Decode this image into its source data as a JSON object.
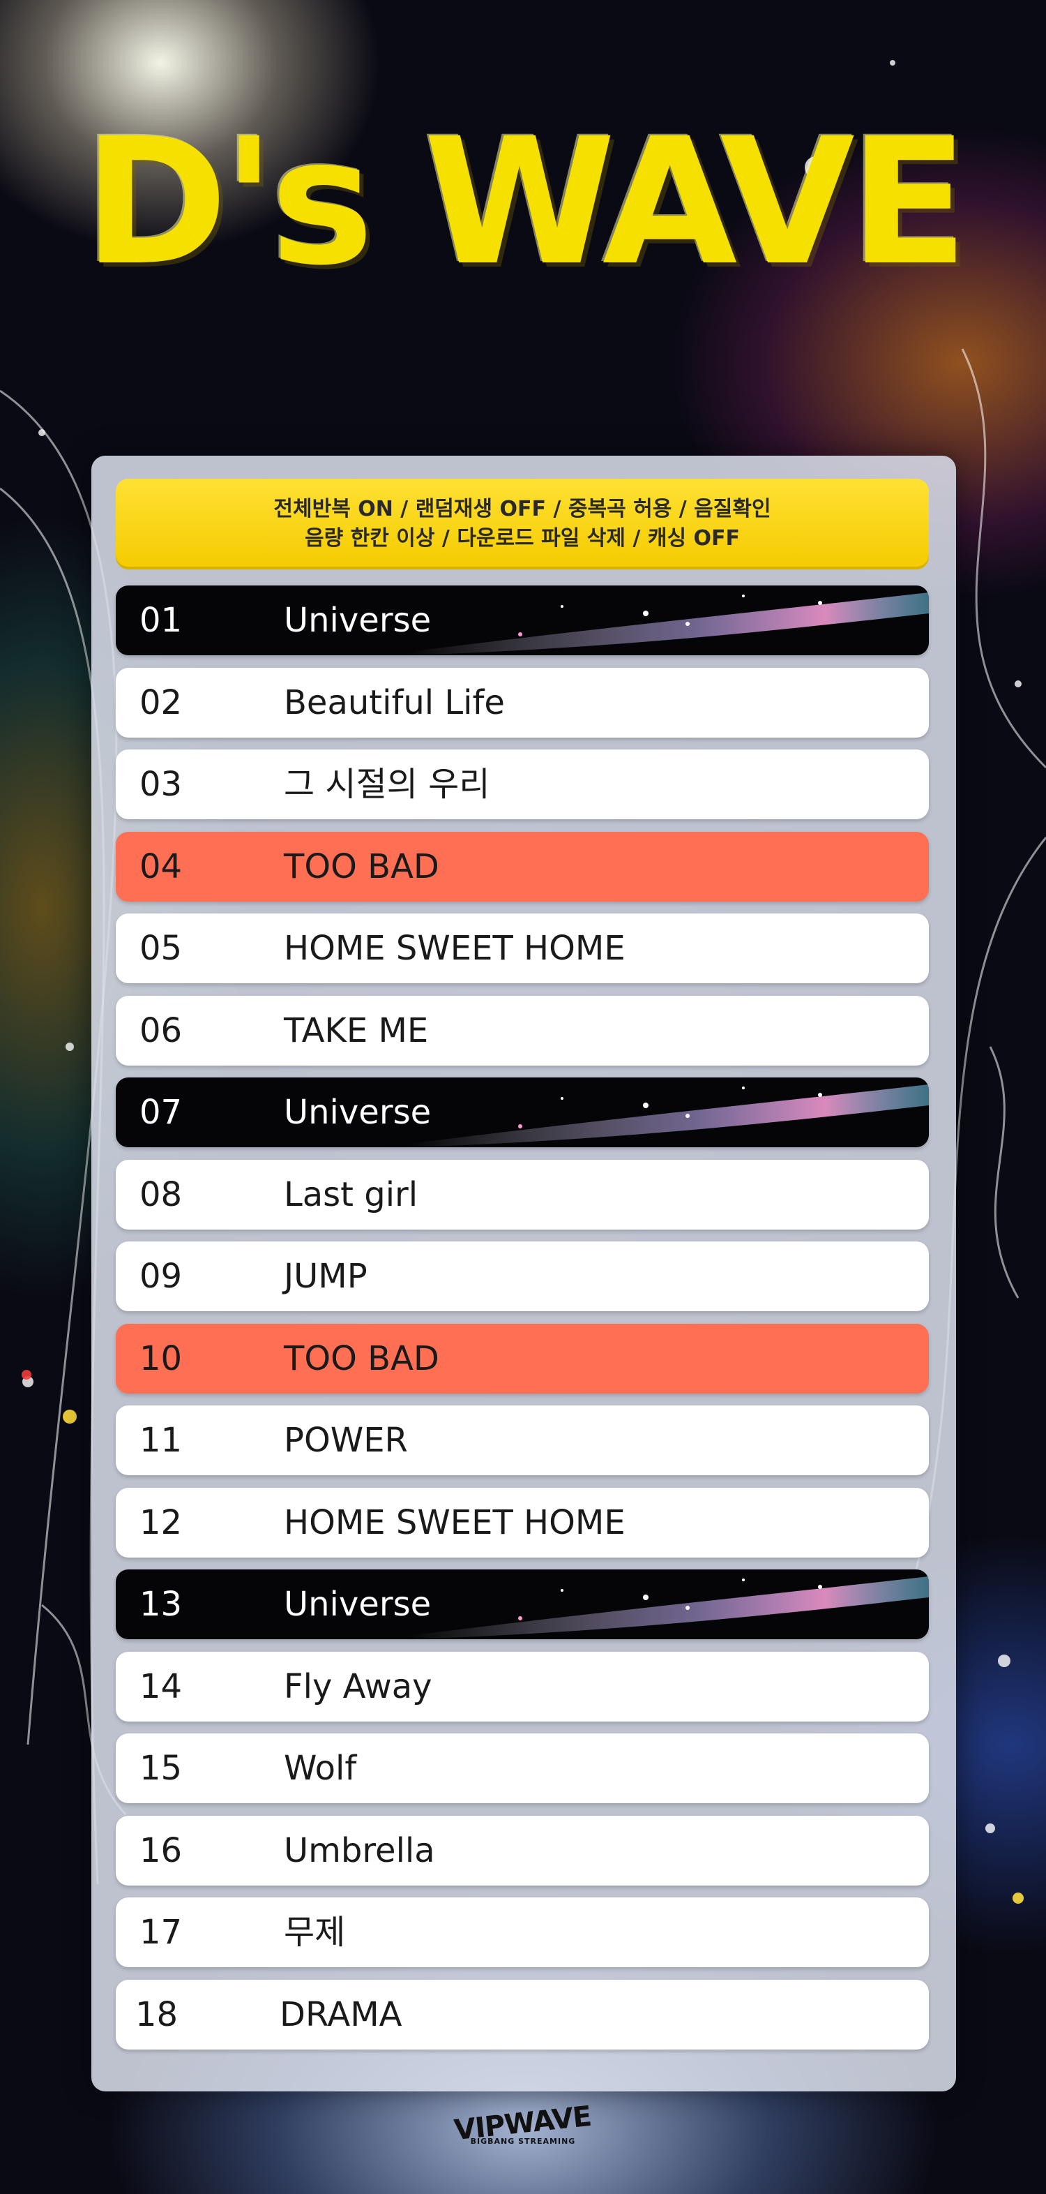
{
  "header": {
    "title": "D's WAVE"
  },
  "notice": {
    "line1": "전체반복 ON / 랜덤재생 OFF / 중복곡 허용 / 음질확인",
    "line2": "음량 한칸 이상 / 다운로드 파일 삭제 / 캐싱 OFF"
  },
  "tracks": [
    {
      "num": "01",
      "title": "Universe"
    },
    {
      "num": "02",
      "title": "Beautiful Life"
    },
    {
      "num": "03",
      "title": "그 시절의 우리"
    },
    {
      "num": "04",
      "title": "TOO BAD"
    },
    {
      "num": "05",
      "title": "HOME SWEET HOME"
    },
    {
      "num": "06",
      "title": "TAKE ME"
    },
    {
      "num": "07",
      "title": "Universe"
    },
    {
      "num": "08",
      "title": "Last girl"
    },
    {
      "num": "09",
      "title": "JUMP"
    },
    {
      "num": "10",
      "title": "TOO BAD"
    },
    {
      "num": "11",
      "title": "POWER"
    },
    {
      "num": "12",
      "title": "HOME SWEET HOME"
    },
    {
      "num": "13",
      "title": "Universe"
    },
    {
      "num": "14",
      "title": "Fly Away"
    },
    {
      "num": "15",
      "title": "Wolf"
    },
    {
      "num": "16",
      "title": "Umbrella"
    },
    {
      "num": "17",
      "title": "무제"
    },
    {
      "num": "18",
      "title": "DRAMA"
    }
  ],
  "footer": {
    "logo": "VIPWAVE",
    "logo_sub": "BIGBANG STREAMING"
  },
  "colors": {
    "title_yellow": "#f5e000",
    "notice_yellow": "#ffd900",
    "highlight_coral": "#fe6f53",
    "dark_row": "#050508",
    "light_row": "#ffffff"
  }
}
